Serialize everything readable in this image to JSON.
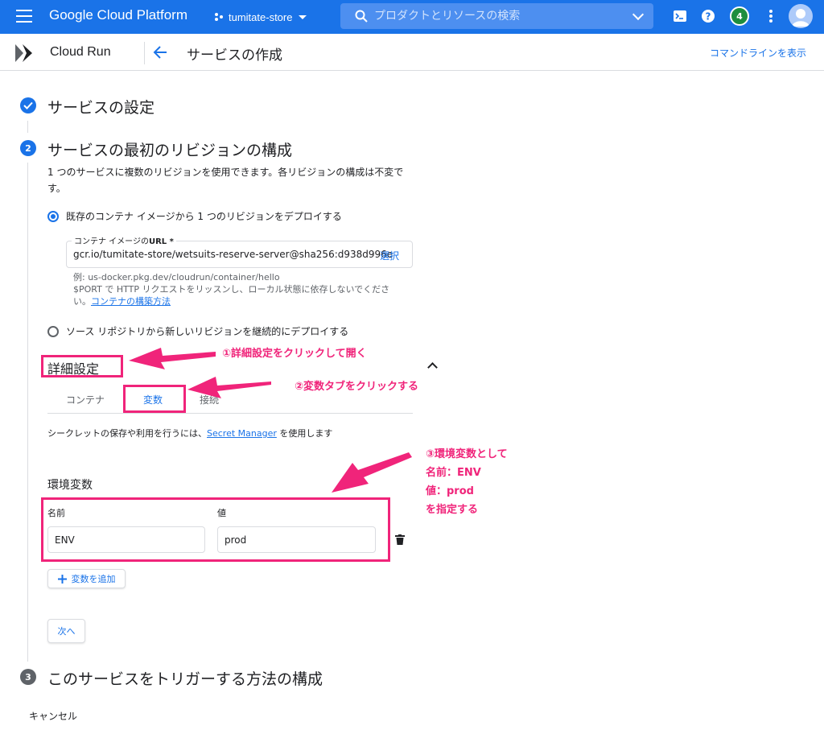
{
  "topbar": {
    "brand": "Google Cloud Platform",
    "project": "tumitate-store",
    "search_placeholder": "プロダクトとリソースの検索",
    "notification_count": "4"
  },
  "subheader": {
    "product": "Cloud Run",
    "page_title": "サービスの作成",
    "cmdline_link": "コマンドラインを表示"
  },
  "steps": [
    {
      "number": "",
      "title": "サービスの設定",
      "state": "done"
    },
    {
      "number": "2",
      "title": "サービスの最初のリビジョンの構成",
      "state": "active"
    },
    {
      "number": "3",
      "title": "このサービスをトリガーする方法の構成",
      "state": "pending"
    }
  ],
  "revision": {
    "description": "1 つのサービスに複数のリビジョンを使用できます。各リビジョンの構成は不変です。",
    "option_existing": "既存のコンテナ イメージから 1 つのリビジョンをデプロイする",
    "url_label": "コンテナ イメージの",
    "url_label_bold": "URL *",
    "url_value": "gcr.io/tumitate-store/wetsuits-reserve-server@sha256:d938d996e",
    "select_label": "選択",
    "hint_line1": "例: us-docker.pkg.dev/cloudrun/container/hello",
    "hint_line2": "$PORT で HTTP リクエストをリッスンし、ローカル状態に依存しないでくださ",
    "hint_line3": "い。",
    "hint_link": "コンテナの構築方法",
    "option_source": "ソース リポジトリから新しいリビジョンを継続的にデプロイする"
  },
  "advanced": {
    "title": "詳細設定",
    "tabs": [
      "コンテナ",
      "変数",
      "接続"
    ],
    "secret_pre": "シークレットの保存や利用を行うには、",
    "secret_link": "Secret Manager",
    "secret_post": " を使用します",
    "env_title": "環境変数",
    "name_label": "名前",
    "value_label": "値",
    "env_name": "ENV",
    "env_value": "prod",
    "add_button": "変数を追加",
    "next_button": "次へ"
  },
  "annotations": {
    "a1": "①詳細設定をクリックして開く",
    "a2": "②変数タブをクリックする",
    "a3_1": "③環境変数として",
    "a3_2": "名前：ENV",
    "a3_3": "値：prod",
    "a3_4": "を指定する"
  },
  "footer": {
    "cancel": "キャンセル"
  },
  "colors": {
    "brand_blue": "#1a73e8",
    "annotation_pink": "#f0247a",
    "badge_green": "#1e8e3e"
  }
}
